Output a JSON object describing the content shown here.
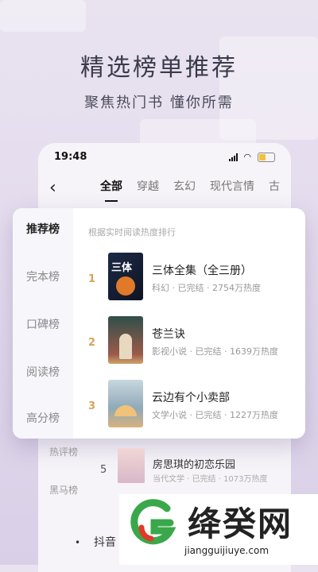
{
  "promo": {
    "headline": "精选榜单推荐",
    "subline": "聚焦热门书 懂你所需"
  },
  "status_bar": {
    "time": "19:48"
  },
  "nav": {
    "back_icon": "chevron-left-icon",
    "tabs": [
      "全部",
      "穿越",
      "玄幻",
      "现代言情",
      "古"
    ],
    "active_tab": "全部"
  },
  "card": {
    "side_items": [
      "推荐榜",
      "完本榜",
      "口碑榜",
      "阅读榜",
      "高分榜"
    ],
    "active_side": "推荐榜",
    "hint": "根据实时阅读热度排行",
    "books": [
      {
        "rank": "1",
        "cover_text": "三体",
        "title": "三体全集（全三册）",
        "meta": "科幻 · 已完结 · 2754万热度"
      },
      {
        "rank": "2",
        "title": "苍兰诀",
        "meta": "影视小说 · 已完结 · 1639万热度"
      },
      {
        "rank": "3",
        "title": "云边有个小卖部",
        "meta": "文学小说 · 已完结 · 1227万热度"
      }
    ]
  },
  "below": {
    "side_items": [
      "热评榜",
      "黑马榜"
    ],
    "book": {
      "rank": "5",
      "title": "房思琪的初恋乐园",
      "meta": "当代文学 · 已完结 · 1073万热度"
    },
    "tiktok_bullet": "•",
    "tiktok_text": "抖音"
  },
  "watermark": {
    "title": "绛癸网",
    "domain": "jiangguijiuye.com",
    "colors": {
      "green": "#3aa84a",
      "red": "#e03a2a"
    }
  }
}
